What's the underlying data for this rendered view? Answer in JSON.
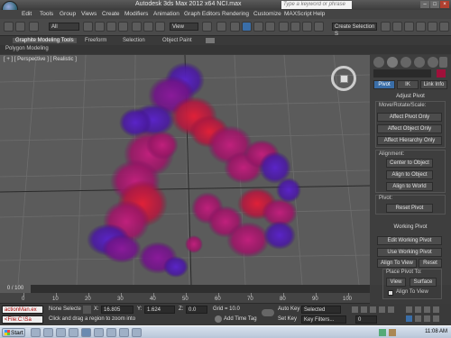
{
  "titlebar": {
    "title": "Autodesk 3ds Max  2012 x64      NCI.max",
    "search_placeholder": "Type a keyword or phrase"
  },
  "menu": [
    "Edit",
    "Tools",
    "Group",
    "Views",
    "Create",
    "Modifiers",
    "Animation",
    "Graph Editors",
    "Rendering",
    "Customize",
    "MAXScript",
    "Help"
  ],
  "toolbar": {
    "selection_filter": "All",
    "ref_coord": "View",
    "named_selection": "Create Selection S"
  },
  "ribbon": {
    "tabs": [
      "Graphite Modeling Tools",
      "Freeform",
      "Selection",
      "Object Paint"
    ],
    "sub_label": "Polygon Modeling"
  },
  "viewport": {
    "label": "[ + ] [ Perspective ] [ Realistic ]"
  },
  "command_panel": {
    "tabs": [
      "Pivot",
      "IK",
      "Link Info"
    ],
    "adjust_pivot": {
      "header": "Adjust Pivot",
      "move_rotate_scale_label": "Move/Rotate/Scale:",
      "buttons": [
        "Affect Pivot Only",
        "Affect Object Only",
        "Affect Hierarchy Only"
      ]
    },
    "alignment": {
      "label": "Alignment:",
      "buttons": [
        "Center to Object",
        "Align to Object",
        "Align to World"
      ]
    },
    "pivot": {
      "label": "Pivot:",
      "button": "Reset Pivot"
    },
    "working_pivot": {
      "header": "Working Pivot",
      "buttons": [
        "Edit Working Pivot",
        "Use Working Pivot"
      ],
      "align_to_view": "Align To View",
      "reset": "Reset",
      "place_pivot_to": "Place Pivot To:",
      "view": "View",
      "surface": "Surface",
      "align_to_view_checkbox": "Align To View"
    }
  },
  "timeline": {
    "slider": "0 / 100",
    "ticks": [
      "0",
      "10",
      "20",
      "30",
      "40",
      "50",
      "60",
      "70",
      "80",
      "90",
      "100"
    ]
  },
  "status": {
    "script_listener_top": "actionMan.ex",
    "script_listener_bottom": "<File:C:\\Sa",
    "selection": "None Selecte",
    "x_label": "X:",
    "x_value": "16.805",
    "y_label": "Y:",
    "y_value": "1.624",
    "z_label": "Z:",
    "z_value": "0.0",
    "grid": "Grid = 10.0",
    "prompt": "Click and drag a region to zoom into",
    "add_time_tag": "Add Time Tag",
    "auto_key": "Auto Key",
    "auto_key_mode": "Selected",
    "set_key": "Set Key",
    "key_filters": "Key Filters...",
    "frame": "0"
  },
  "taskbar": {
    "start": "Start",
    "clock": "11:08 AM"
  },
  "colors": {
    "accent_blue": "#3a6ea8",
    "particle_magenta": "#b0207a",
    "particle_red": "#d8203c",
    "particle_violet": "#5a1fb8"
  }
}
